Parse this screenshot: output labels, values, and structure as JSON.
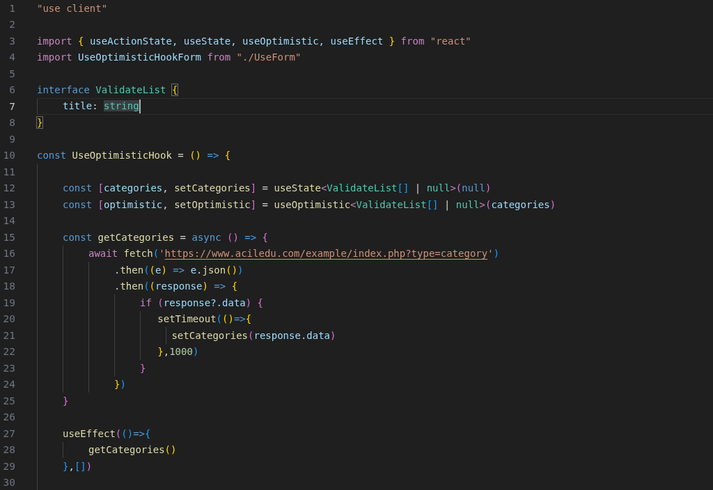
{
  "editor": {
    "lines": [
      {
        "number": "1",
        "current": false,
        "tokens": [
          {
            "text": "\"use client\"",
            "kind": "str"
          }
        ]
      },
      {
        "number": "2",
        "current": false
      },
      {
        "number": "3",
        "current": false,
        "tokens": [
          {
            "text": "import ",
            "kind": "kw"
          },
          {
            "text": "{",
            "kind": "b1"
          },
          {
            "text": " useActionState, useState, useOptimistic, useEffect ",
            "kind": "var"
          },
          {
            "text": "}",
            "kind": "b1"
          },
          {
            "text": " from ",
            "kind": "kw"
          },
          {
            "text": "\"react\"",
            "kind": "str"
          }
        ]
      },
      {
        "number": "4",
        "current": false,
        "tokens": [
          {
            "text": "import ",
            "kind": "kw"
          },
          {
            "text": "UseOptimisticHookForm ",
            "kind": "var"
          },
          {
            "text": "from ",
            "kind": "kw"
          },
          {
            "text": "\"./UseForm\"",
            "kind": "str"
          }
        ]
      },
      {
        "number": "5",
        "current": false
      },
      {
        "number": "6",
        "current": false,
        "tokens": [
          {
            "text": "interface ",
            "kind": "st"
          },
          {
            "text": "ValidateList ",
            "kind": "type"
          },
          {
            "text": "{",
            "kind": "b1",
            "boxed": true
          }
        ]
      },
      {
        "number": "7",
        "current": true,
        "tokens": [
          {
            "text": "\ttitle",
            "kind": "var"
          },
          {
            "text": ": ",
            "kind": "pl"
          },
          {
            "text": "string",
            "kind": "type",
            "selected": true
          }
        ]
      },
      {
        "number": "8",
        "current": false,
        "tokens": [
          {
            "text": "}",
            "kind": "b1",
            "boxed": true
          }
        ]
      },
      {
        "number": "9",
        "current": false
      },
      {
        "number": "10",
        "current": false,
        "tokens": [
          {
            "text": "const ",
            "kind": "st"
          },
          {
            "text": "UseOptimisticHook",
            "kind": "fn"
          },
          {
            "text": " = ",
            "kind": "pl"
          },
          {
            "text": "()",
            "kind": "b1"
          },
          {
            "text": " => ",
            "kind": "st"
          },
          {
            "text": "{",
            "kind": "b1"
          }
        ]
      },
      {
        "number": "11",
        "current": false
      },
      {
        "number": "12",
        "current": false,
        "tokens": [
          {
            "text": "\tconst ",
            "kind": "st"
          },
          {
            "text": "[",
            "kind": "b2"
          },
          {
            "text": "categories",
            "kind": "var"
          },
          {
            "text": ", ",
            "kind": "pl"
          },
          {
            "text": "setCategories",
            "kind": "fn"
          },
          {
            "text": "]",
            "kind": "b2"
          },
          {
            "text": " = ",
            "kind": "pl"
          },
          {
            "text": "useState",
            "kind": "fn"
          },
          {
            "text": "<",
            "kind": "kw"
          },
          {
            "text": "ValidateList",
            "kind": "type"
          },
          {
            "text": "[]",
            "kind": "b3"
          },
          {
            "text": " | ",
            "kind": "pl"
          },
          {
            "text": "null",
            "kind": "type"
          },
          {
            "text": ">",
            "kind": "kw"
          },
          {
            "text": "(",
            "kind": "b2"
          },
          {
            "text": "null",
            "kind": "st"
          },
          {
            "text": ")",
            "kind": "b2"
          }
        ]
      },
      {
        "number": "13",
        "current": false,
        "tokens": [
          {
            "text": "\tconst ",
            "kind": "st"
          },
          {
            "text": "[",
            "kind": "b2"
          },
          {
            "text": "optimistic",
            "kind": "var"
          },
          {
            "text": ", ",
            "kind": "pl"
          },
          {
            "text": "setOptimistic",
            "kind": "fn"
          },
          {
            "text": "]",
            "kind": "b2"
          },
          {
            "text": " = ",
            "kind": "pl"
          },
          {
            "text": "useOptimistic",
            "kind": "fn"
          },
          {
            "text": "<",
            "kind": "kw"
          },
          {
            "text": "ValidateList",
            "kind": "type"
          },
          {
            "text": "[]",
            "kind": "b3"
          },
          {
            "text": " | ",
            "kind": "pl"
          },
          {
            "text": "null",
            "kind": "type"
          },
          {
            "text": ">",
            "kind": "kw"
          },
          {
            "text": "(",
            "kind": "b2"
          },
          {
            "text": "categories",
            "kind": "var"
          },
          {
            "text": ")",
            "kind": "b2"
          }
        ]
      },
      {
        "number": "14",
        "current": false
      },
      {
        "number": "15",
        "current": false,
        "tokens": [
          {
            "text": "\tconst ",
            "kind": "st"
          },
          {
            "text": "getCategories",
            "kind": "fn"
          },
          {
            "text": " = ",
            "kind": "pl"
          },
          {
            "text": "async ",
            "kind": "st"
          },
          {
            "text": "()",
            "kind": "b2"
          },
          {
            "text": " => ",
            "kind": "st"
          },
          {
            "text": "{",
            "kind": "b2"
          }
        ]
      },
      {
        "number": "16",
        "current": false,
        "tokens": [
          {
            "text": "\t\tawait ",
            "kind": "kw"
          },
          {
            "text": "fetch",
            "kind": "fn"
          },
          {
            "text": "(",
            "kind": "b3"
          },
          {
            "text": "'",
            "kind": "str"
          },
          {
            "text": "https://www.aciledu.com/example/index.php?type=category",
            "kind": "link"
          },
          {
            "text": "'",
            "kind": "str"
          },
          {
            "text": ")",
            "kind": "b3"
          }
        ]
      },
      {
        "number": "17",
        "current": false,
        "tokens": [
          {
            "text": "\t\t\t.",
            "kind": "pl"
          },
          {
            "text": "then",
            "kind": "fn"
          },
          {
            "text": "(",
            "kind": "b3"
          },
          {
            "text": "(",
            "kind": "b1"
          },
          {
            "text": "e",
            "kind": "var"
          },
          {
            "text": ")",
            "kind": "b1"
          },
          {
            "text": " => ",
            "kind": "st"
          },
          {
            "text": "e",
            "kind": "var"
          },
          {
            "text": ".",
            "kind": "pl"
          },
          {
            "text": "json",
            "kind": "fn"
          },
          {
            "text": "()",
            "kind": "b1"
          },
          {
            "text": ")",
            "kind": "b3"
          }
        ]
      },
      {
        "number": "18",
        "current": false,
        "tokens": [
          {
            "text": "\t\t\t.",
            "kind": "pl"
          },
          {
            "text": "then",
            "kind": "fn"
          },
          {
            "text": "(",
            "kind": "b3"
          },
          {
            "text": "(",
            "kind": "b1"
          },
          {
            "text": "response",
            "kind": "var"
          },
          {
            "text": ")",
            "kind": "b1"
          },
          {
            "text": " => ",
            "kind": "st"
          },
          {
            "text": "{",
            "kind": "b1"
          }
        ]
      },
      {
        "number": "19",
        "current": false,
        "tokens": [
          {
            "text": "\t\t\t\tif ",
            "kind": "kw"
          },
          {
            "text": "(",
            "kind": "b2"
          },
          {
            "text": "response?.data",
            "kind": "var"
          },
          {
            "text": ")",
            "kind": "b2"
          },
          {
            "text": " {",
            "kind": "b2"
          }
        ]
      },
      {
        "number": "20",
        "current": false,
        "tokens": [
          {
            "text": "\t\t\t\t   setTimeout",
            "kind": "fn"
          },
          {
            "text": "(",
            "kind": "b3"
          },
          {
            "text": "()",
            "kind": "b1"
          },
          {
            "text": "=>",
            "kind": "st"
          },
          {
            "text": "{",
            "kind": "b1"
          }
        ]
      },
      {
        "number": "21",
        "current": false,
        "tokens": [
          {
            "text": "\t\t\t\t\t setCategories",
            "kind": "fn"
          },
          {
            "text": "(",
            "kind": "b2"
          },
          {
            "text": "response.data",
            "kind": "var"
          },
          {
            "text": ")",
            "kind": "b2"
          }
        ]
      },
      {
        "number": "22",
        "current": false,
        "tokens": [
          {
            "text": "\t\t\t\t   }",
            "kind": "b1"
          },
          {
            "text": ",",
            "kind": "pl"
          },
          {
            "text": "1000",
            "kind": "num"
          },
          {
            "text": ")",
            "kind": "b3"
          }
        ]
      },
      {
        "number": "23",
        "current": false,
        "tokens": [
          {
            "text": "\t\t\t\t}",
            "kind": "b2"
          }
        ]
      },
      {
        "number": "24",
        "current": false,
        "tokens": [
          {
            "text": "\t\t\t}",
            "kind": "b1"
          },
          {
            "text": ")",
            "kind": "b3"
          }
        ]
      },
      {
        "number": "25",
        "current": false,
        "tokens": [
          {
            "text": "\t}",
            "kind": "b2"
          }
        ]
      },
      {
        "number": "26",
        "current": false
      },
      {
        "number": "27",
        "current": false,
        "tokens": [
          {
            "text": "\tuseEffect",
            "kind": "fn"
          },
          {
            "text": "(",
            "kind": "b2"
          },
          {
            "text": "()",
            "kind": "b3"
          },
          {
            "text": "=>",
            "kind": "st"
          },
          {
            "text": "{",
            "kind": "b3"
          }
        ]
      },
      {
        "number": "28",
        "current": false,
        "tokens": [
          {
            "text": "\t\tgetCategories",
            "kind": "fn"
          },
          {
            "text": "()",
            "kind": "b1"
          }
        ]
      },
      {
        "number": "29",
        "current": false,
        "tokens": [
          {
            "text": "\t}",
            "kind": "b3"
          },
          {
            "text": ",",
            "kind": "pl"
          },
          {
            "text": "[]",
            "kind": "b3"
          },
          {
            "text": ")",
            "kind": "b2"
          }
        ]
      },
      {
        "number": "30",
        "current": false
      }
    ]
  }
}
